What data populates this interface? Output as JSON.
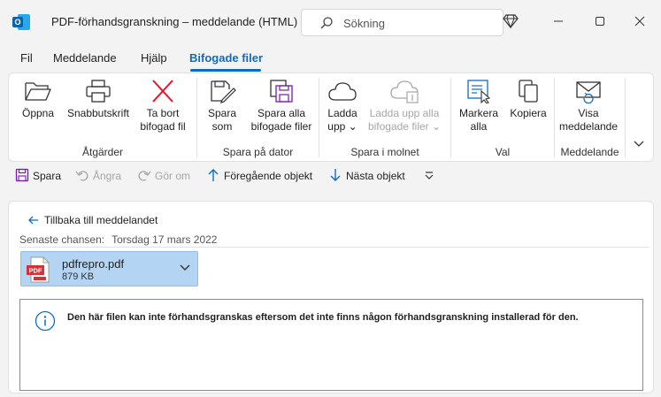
{
  "window": {
    "title": "PDF-förhandsgranskning – meddelande (HTML)",
    "app_icon_letter": "O",
    "search_placeholder": "Sökning"
  },
  "tabs": [
    {
      "label": "Fil"
    },
    {
      "label": "Meddelande"
    },
    {
      "label": "Hjälp"
    },
    {
      "label": "Bifogade filer",
      "active": true
    }
  ],
  "ribbon": {
    "groups": [
      {
        "label": "Åtgärder"
      },
      {
        "label": "Spara på dator"
      },
      {
        "label": "Spara i molnet"
      },
      {
        "label": "Val"
      },
      {
        "label": "Meddelande"
      }
    ],
    "buttons": {
      "open": {
        "line1": "Öppna",
        "line2": ""
      },
      "quickprint": {
        "line1": "Snabbutskrift",
        "line2": ""
      },
      "remove": {
        "line1": "Ta bort",
        "line2": "bifogad fil"
      },
      "save_as": {
        "line1": "Spara",
        "line2": "som"
      },
      "save_all": {
        "line1": "Spara alla",
        "line2": "bifogade filer"
      },
      "upload": {
        "line1": "Ladda",
        "line2": "upp ⌄"
      },
      "upload_all": {
        "line1": "Ladda upp alla",
        "line2": "bifogade filer ⌄"
      },
      "select_all": {
        "line1": "Markera",
        "line2": "alla"
      },
      "copy": {
        "line1": "Kopiera",
        "line2": ""
      },
      "show_message": {
        "line1": "Visa",
        "line2": "meddelande"
      }
    }
  },
  "quick_access": {
    "save": "Spara",
    "undo": "Ångra",
    "redo": "Gör om",
    "previous": "Föregående objekt",
    "next": "Nästa objekt"
  },
  "content": {
    "back_link": "Tillbaka till meddelandet",
    "deadline_label": "Senaste chansen:",
    "deadline_value": "Torsdag 17 mars 2022",
    "attachment": {
      "name": "pdfrepro.pdf",
      "size": "879 KB",
      "badge": "PDF"
    },
    "preview_message": "Den här filen kan inte förhandsgranskas eftersom det inte finns någon förhandsgranskning installerad för den."
  },
  "colors": {
    "accent": "#0f6cbd",
    "attachment_bg": "#b3d5f3",
    "remove_red": "#e81123",
    "pdf_red": "#d13438"
  }
}
